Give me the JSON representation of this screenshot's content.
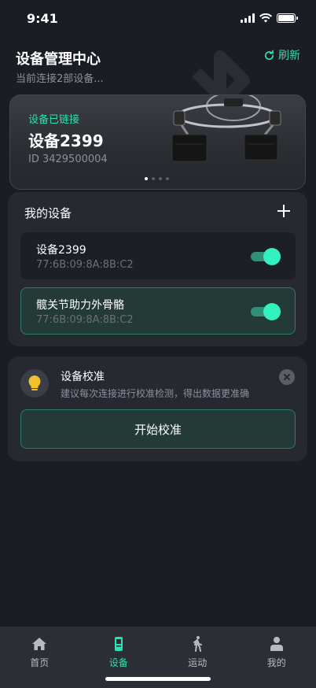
{
  "status_bar": {
    "time": "9:41"
  },
  "header": {
    "title": "设备管理中心",
    "subtitle": "当前连接2部设备...",
    "refresh_label": "刷新"
  },
  "hero": {
    "status": "设备已链接",
    "device_name": "设备2399",
    "device_id": "ID 3429500004",
    "carousel_pages": 4,
    "carousel_active": 1
  },
  "devices": {
    "title": "我的设备",
    "items": [
      {
        "name": "设备2399",
        "mac": "77:6B:09:8A:8B:C2",
        "enabled": true
      },
      {
        "name": "髋关节助力外骨骼",
        "mac": "77:6B:09:8A:8B:C2",
        "enabled": true
      }
    ]
  },
  "calibration": {
    "title": "设备校准",
    "description": "建议每次连接进行校准检测，得出数据更准确",
    "button_label": "开始校准"
  },
  "tabs": [
    {
      "label": "首页",
      "icon": "home-icon",
      "active": false
    },
    {
      "label": "设备",
      "icon": "phone-device-icon",
      "active": true
    },
    {
      "label": "运动",
      "icon": "walking-icon",
      "active": false
    },
    {
      "label": "我的",
      "icon": "person-icon",
      "active": false
    }
  ],
  "colors": {
    "background": "#1a1d24",
    "accent": "#2fe0b0",
    "panel": "#262930",
    "toggle_on": "#33f0bf"
  }
}
